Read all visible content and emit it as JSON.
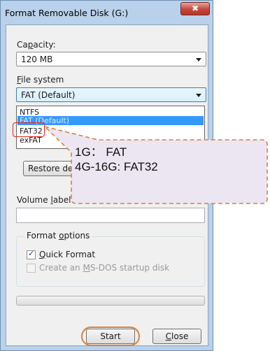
{
  "window": {
    "title": "Format Removable Disk (G:)",
    "close_icon": "✖"
  },
  "capacity": {
    "label": "Capacity:",
    "value": "120 MB"
  },
  "file_system": {
    "label": "File system",
    "value": "FAT (Default)",
    "options": [
      "NTFS",
      "FAT (Default)",
      "FAT32",
      "exFAT"
    ],
    "highlighted_option": "FAT (Default)"
  },
  "restore_button": {
    "label": "Restore de"
  },
  "volume_label": {
    "label": "Volume label",
    "value": ""
  },
  "format_options": {
    "title": "Format options",
    "quick_format": {
      "label": "Quick Format",
      "checked": true
    },
    "msdos_disk": {
      "label": "Create an MS-DOS startup disk",
      "checked": false,
      "enabled": false
    }
  },
  "progress": {
    "value": 0
  },
  "buttons": {
    "start": "Start",
    "close": "Close"
  },
  "annotation": {
    "line1": "1G： FAT",
    "line2": "4G-16G: FAT32",
    "highlight_color": "#e0251b",
    "callout_border": "#d9803a",
    "callout_fill": "#ece6f2"
  }
}
